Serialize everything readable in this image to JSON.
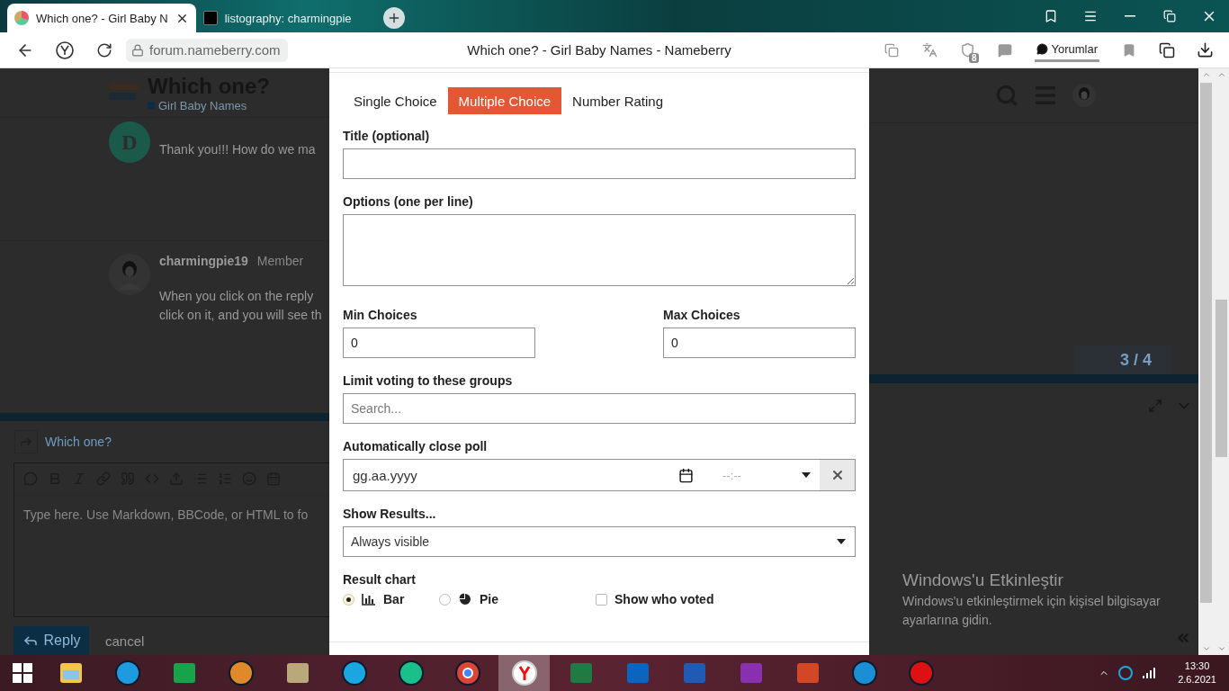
{
  "browser": {
    "tabs": [
      {
        "title": "Which one? - Girl Baby N",
        "selected": true
      },
      {
        "title": "listography: charmingpie",
        "selected": false
      }
    ],
    "url": "forum.nameberry.com",
    "page_title": "Which one? - Girl Baby Names - Nameberry",
    "shield_count": "8",
    "comments_label": "Yorumlar"
  },
  "forum": {
    "header": {
      "title": "Which one?",
      "category": "Girl Baby Names"
    },
    "posts": [
      {
        "kind": "letter",
        "avatar": "D",
        "lines": [
          "Thank you!!! How do we ma"
        ]
      },
      {
        "kind": "photo",
        "author": "charmingpie19",
        "role": "Member",
        "lines": [
          "When you click on the reply",
          "click on it, and you will see th"
        ]
      }
    ],
    "pager": "3 / 4",
    "composer": {
      "title": "Which one?",
      "placeholder": "Type here. Use Markdown, BBCode, or HTML to fo",
      "reply_label": "Reply",
      "cancel_label": "cancel"
    }
  },
  "modal": {
    "tabs": [
      {
        "label": "Single Choice",
        "selected": false
      },
      {
        "label": "Multiple Choice",
        "selected": true
      },
      {
        "label": "Number Rating",
        "selected": false
      }
    ],
    "title_label": "Title (optional)",
    "options_label": "Options (one per line)",
    "min_label": "Min Choices",
    "min_value": "0",
    "max_label": "Max Choices",
    "max_value": "0",
    "groups_label": "Limit voting to these groups",
    "groups_placeholder": "Search...",
    "close_label": "Automatically close poll",
    "date_placeholder": "gg.aa.yyyy",
    "time_placeholder": "--:--",
    "results_label": "Show Results...",
    "results_value": "Always visible",
    "chart_label": "Result chart",
    "chart_options": [
      {
        "kind": "bar",
        "label": "Bar",
        "selected": true
      },
      {
        "kind": "pie",
        "label": "Pie",
        "selected": false
      }
    ],
    "show_voters": {
      "label": "Show who voted",
      "checked": false
    }
  },
  "windows_notice": {
    "title": "Windows'u Etkinleştir",
    "text": "Windows'u etkinleştirmek için kişisel bilgisayar ayarlarına gidin."
  },
  "taskbar": {
    "apps": [
      {
        "kind": "explorer",
        "selected": false
      },
      {
        "kind": "ie",
        "selected": false
      },
      {
        "kind": "store",
        "selected": false
      },
      {
        "kind": "media",
        "selected": false
      },
      {
        "kind": "notes",
        "selected": false
      },
      {
        "kind": "c-app",
        "selected": false
      },
      {
        "kind": "u-app",
        "selected": false
      },
      {
        "kind": "chrome",
        "selected": false
      },
      {
        "kind": "yandex",
        "selected": true
      },
      {
        "kind": "excel",
        "selected": false
      },
      {
        "kind": "outlook",
        "selected": false
      },
      {
        "kind": "word",
        "selected": false
      },
      {
        "kind": "onenote",
        "selected": false
      },
      {
        "kind": "powerpoint",
        "selected": false
      },
      {
        "kind": "edge",
        "selected": false
      },
      {
        "kind": "gear",
        "selected": false
      }
    ],
    "time": "13:30",
    "date": "2.6.2021"
  }
}
